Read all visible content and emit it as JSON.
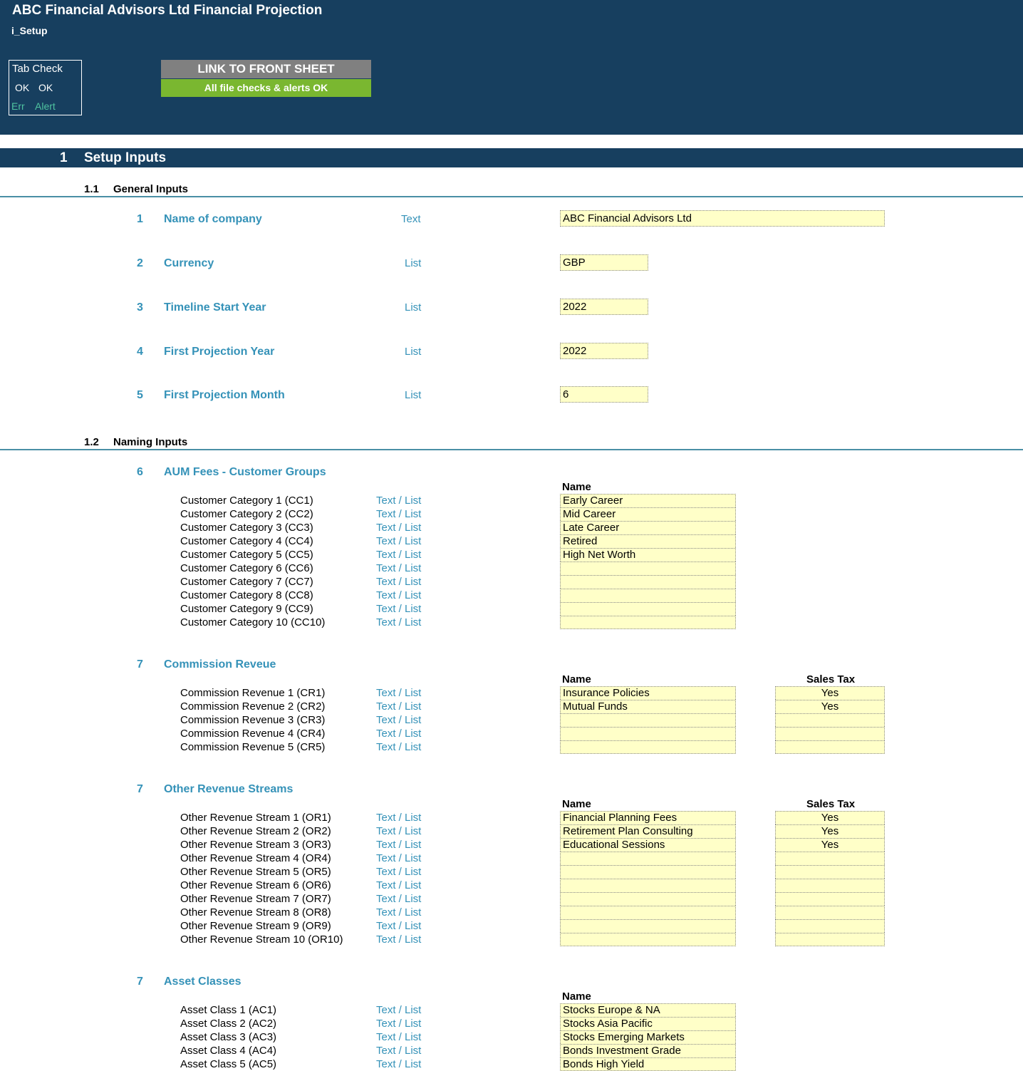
{
  "header": {
    "title": "ABC Financial Advisors Ltd Financial Projection",
    "sheet": "i_Setup",
    "tab_check": {
      "title": "Tab Check",
      "ok1": "OK",
      "ok2": "OK",
      "err": "Err",
      "alert": "Alert"
    },
    "link_button": "LINK TO FRONT SHEET",
    "status": "All file checks & alerts OK"
  },
  "section": {
    "number": "1",
    "title": "Setup Inputs"
  },
  "general": {
    "number": "1.1",
    "title": "General Inputs",
    "items": [
      {
        "num": "1",
        "label": "Name of company",
        "type": "Text",
        "value": "ABC Financial Advisors Ltd"
      },
      {
        "num": "2",
        "label": "Currency",
        "type": "List",
        "value": "GBP"
      },
      {
        "num": "3",
        "label": "Timeline Start Year",
        "type": "List",
        "value": "2022"
      },
      {
        "num": "4",
        "label": "First Projection Year",
        "type": "List",
        "value": "2022"
      },
      {
        "num": "5",
        "label": "First Projection Month",
        "type": "List",
        "value": "6"
      }
    ]
  },
  "naming": {
    "number": "1.2",
    "title": "Naming Inputs",
    "name_header": "Name",
    "tax_header": "Sales Tax",
    "type_label": "Text / List",
    "groups": [
      {
        "num": "6",
        "title": "AUM Fees - Customer Groups",
        "rows": [
          {
            "label": "Customer Category 1 (CC1)",
            "name": "Early Career"
          },
          {
            "label": "Customer Category 2 (CC2)",
            "name": "Mid Career"
          },
          {
            "label": "Customer Category 3 (CC3)",
            "name": "Late Career"
          },
          {
            "label": "Customer Category 4 (CC4)",
            "name": "Retired"
          },
          {
            "label": "Customer Category 5 (CC5)",
            "name": "High Net Worth"
          },
          {
            "label": "Customer Category 6 (CC6)",
            "name": ""
          },
          {
            "label": "Customer Category 7 (CC7)",
            "name": ""
          },
          {
            "label": "Customer Category 8 (CC8)",
            "name": ""
          },
          {
            "label": "Customer Category 9 (CC9)",
            "name": ""
          },
          {
            "label": "Customer Category 10 (CC10)",
            "name": ""
          }
        ]
      },
      {
        "num": "7",
        "title": "Commission Reveue",
        "rows": [
          {
            "label": "Commission Revenue 1 (CR1)",
            "name": "Insurance Policies",
            "tax": "Yes"
          },
          {
            "label": "Commission Revenue 2 (CR2)",
            "name": "Mutual Funds",
            "tax": "Yes"
          },
          {
            "label": "Commission Revenue 3 (CR3)",
            "name": "",
            "tax": ""
          },
          {
            "label": "Commission Revenue 4 (CR4)",
            "name": "",
            "tax": ""
          },
          {
            "label": "Commission Revenue 5 (CR5)",
            "name": "",
            "tax": ""
          }
        ]
      },
      {
        "num": "7",
        "title": "Other Revenue Streams",
        "rows": [
          {
            "label": "Other Revenue Stream 1 (OR1)",
            "name": "Financial Planning Fees",
            "tax": "Yes"
          },
          {
            "label": "Other Revenue Stream 2 (OR2)",
            "name": "Retirement Plan Consulting",
            "tax": "Yes"
          },
          {
            "label": "Other Revenue Stream 3 (OR3)",
            "name": "Educational Sessions",
            "tax": "Yes"
          },
          {
            "label": "Other Revenue Stream 4 (OR4)",
            "name": "",
            "tax": ""
          },
          {
            "label": "Other Revenue Stream 5 (OR5)",
            "name": "",
            "tax": ""
          },
          {
            "label": "Other Revenue Stream 6 (OR6)",
            "name": "",
            "tax": ""
          },
          {
            "label": "Other Revenue Stream 7 (OR7)",
            "name": "",
            "tax": ""
          },
          {
            "label": "Other Revenue Stream 8 (OR8)",
            "name": "",
            "tax": ""
          },
          {
            "label": "Other Revenue Stream 9 (OR9)",
            "name": "",
            "tax": ""
          },
          {
            "label": "Other Revenue Stream 10 (OR10)",
            "name": "",
            "tax": ""
          }
        ]
      },
      {
        "num": "7",
        "title": "Asset Classes",
        "rows": [
          {
            "label": "Asset Class 1 (AC1)",
            "name": "Stocks Europe & NA"
          },
          {
            "label": "Asset Class 2 (AC2)",
            "name": "Stocks Asia Pacific"
          },
          {
            "label": "Asset Class 3 (AC3)",
            "name": "Stocks Emerging Markets"
          },
          {
            "label": "Asset Class 4 (AC4)",
            "name": "Bonds Investment Grade"
          },
          {
            "label": "Asset Class 5 (AC5)",
            "name": "Bonds High Yield"
          }
        ]
      }
    ]
  }
}
